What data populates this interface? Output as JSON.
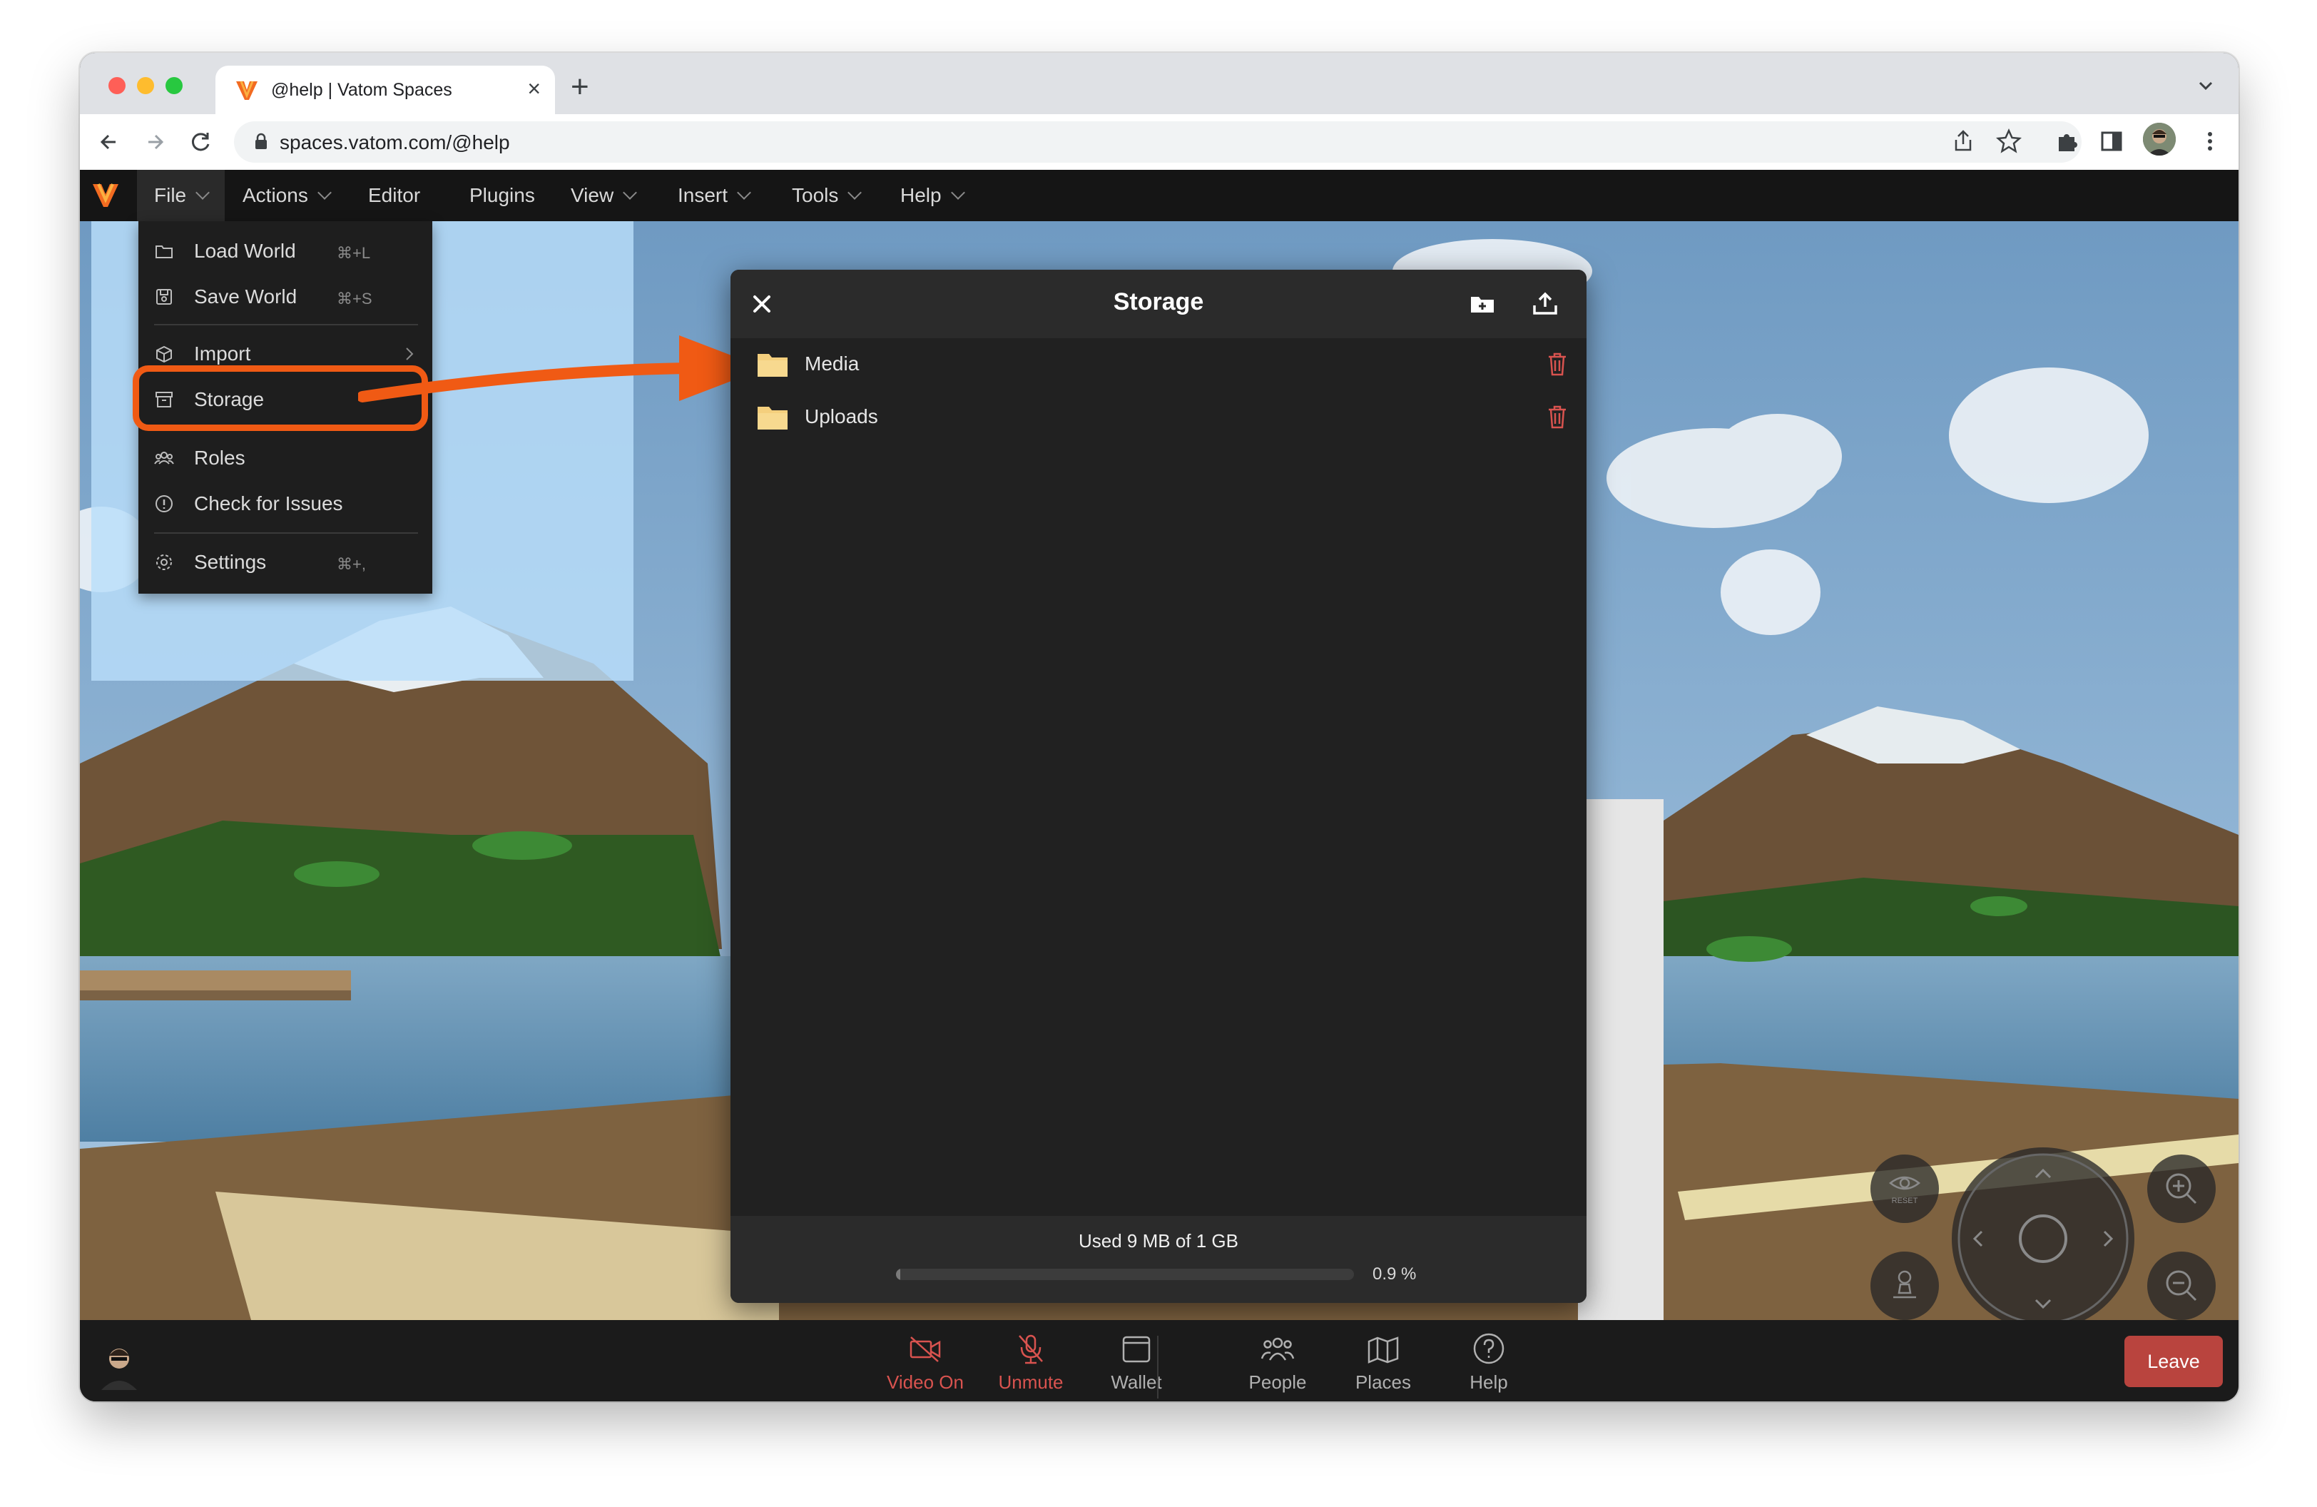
{
  "browser": {
    "tab_title": "@help | Vatom Spaces",
    "tab_close": "×",
    "new_tab": "+",
    "url": "spaces.vatom.com/@help"
  },
  "menubar": {
    "items": [
      {
        "label": "File",
        "has_chevron": true
      },
      {
        "label": "Actions",
        "has_chevron": true
      },
      {
        "label": "Editor",
        "has_chevron": false
      },
      {
        "label": "Plugins",
        "has_chevron": false
      },
      {
        "label": "View",
        "has_chevron": true
      },
      {
        "label": "Insert",
        "has_chevron": true
      },
      {
        "label": "Tools",
        "has_chevron": true
      },
      {
        "label": "Help",
        "has_chevron": true
      }
    ]
  },
  "file_menu": {
    "items": [
      {
        "label": "Load World",
        "shortcut": "⌘+L",
        "icon": "folder-icon"
      },
      {
        "label": "Save World",
        "shortcut": "⌘+S",
        "icon": "save-icon"
      },
      {
        "label": "Import",
        "shortcut": "",
        "icon": "box-icon"
      },
      {
        "label": "Storage",
        "shortcut": "",
        "icon": "archive-icon"
      },
      {
        "label": "Roles",
        "shortcut": "",
        "icon": "people-icon"
      },
      {
        "label": "Check for Issues",
        "shortcut": "",
        "icon": "info-icon"
      },
      {
        "label": "Settings",
        "shortcut": "⌘+,",
        "icon": "gear-icon"
      }
    ]
  },
  "storage_modal": {
    "title": "Storage",
    "folders": [
      {
        "name": "Media"
      },
      {
        "name": "Uploads"
      }
    ],
    "usage_text": "Used 9 MB of 1 GB",
    "usage_percent_text": "0.9 %",
    "usage_fraction": 0.009
  },
  "bottombar": {
    "buttons": [
      {
        "label": "Video On",
        "icon": "video-off-icon",
        "color": "#d9534f"
      },
      {
        "label": "Unmute",
        "icon": "mic-off-icon",
        "color": "#d9534f"
      },
      {
        "label": "Wallet",
        "icon": "wallet-icon",
        "color": "#b0b0b0"
      },
      {
        "label": "People",
        "icon": "people-icon",
        "color": "#b0b0b0"
      },
      {
        "label": "Places",
        "icon": "map-icon",
        "color": "#b0b0b0"
      },
      {
        "label": "Help",
        "icon": "help-icon",
        "color": "#b0b0b0"
      }
    ],
    "leave_label": "Leave"
  },
  "controls": {
    "reset_label": "RESET"
  },
  "colors": {
    "accent_orange": "#f05a14",
    "danger_red": "#d9534f",
    "leave_red": "#b9443e"
  }
}
